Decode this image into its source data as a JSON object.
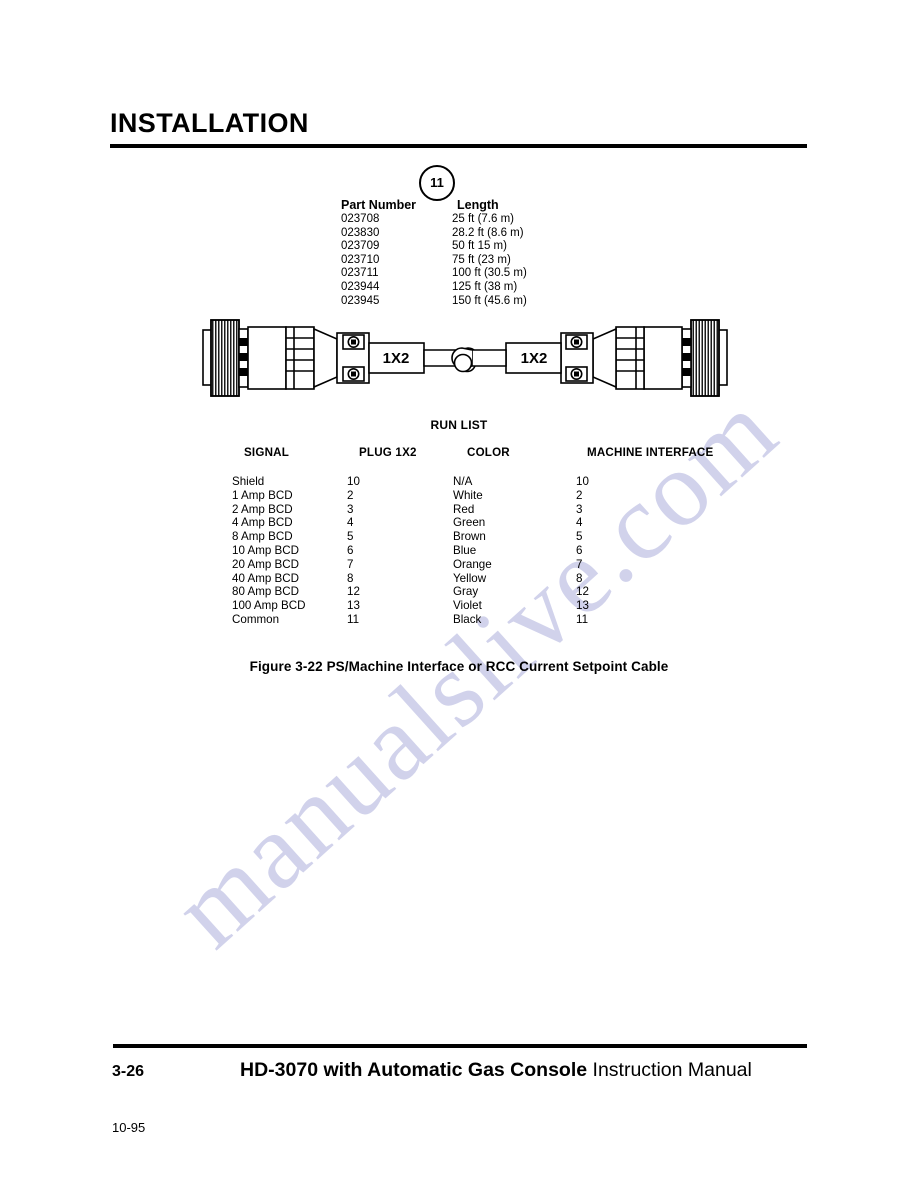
{
  "header": {
    "title": "INSTALLATION"
  },
  "callout": {
    "number": "11"
  },
  "part_table": {
    "headers": [
      "Part Number",
      "Length"
    ],
    "rows": [
      {
        "part_number": "023708",
        "length": "25 ft (7.6 m)"
      },
      {
        "part_number": "023830",
        "length": "28.2 ft (8.6 m)"
      },
      {
        "part_number": "023709",
        "length": "50 ft 15 m)"
      },
      {
        "part_number": "023710",
        "length": "75 ft (23 m)"
      },
      {
        "part_number": "023711",
        "length": "100 ft (30.5 m)"
      },
      {
        "part_number": "023944",
        "length": "125 ft (38 m)"
      },
      {
        "part_number": "023945",
        "length": "150 ft (45.6 m)"
      }
    ]
  },
  "connectors": {
    "left_label": "1X2",
    "right_label": "1X2"
  },
  "run_list": {
    "title": "RUN LIST",
    "headers": [
      "SIGNAL",
      "PLUG 1X2",
      "COLOR",
      "MACHINE INTERFACE"
    ],
    "rows": [
      {
        "signal": "Shield",
        "plug": "10",
        "color": "N/A",
        "machine": "10"
      },
      {
        "signal": "1 Amp BCD",
        "plug": "2",
        "color": "White",
        "machine": "2"
      },
      {
        "signal": "2 Amp BCD",
        "plug": "3",
        "color": "Red",
        "machine": "3"
      },
      {
        "signal": "4 Amp BCD",
        "plug": "4",
        "color": "Green",
        "machine": "4"
      },
      {
        "signal": "8 Amp BCD",
        "plug": "5",
        "color": "Brown",
        "machine": "5"
      },
      {
        "signal": "10 Amp BCD",
        "plug": "6",
        "color": "Blue",
        "machine": "6"
      },
      {
        "signal": "20 Amp BCD",
        "plug": "7",
        "color": "Orange",
        "machine": "7"
      },
      {
        "signal": "40 Amp BCD",
        "plug": "8",
        "color": "Yellow",
        "machine": "8"
      },
      {
        "signal": "80 Amp BCD",
        "plug": "12",
        "color": "Gray",
        "machine": "12"
      },
      {
        "signal": "100 Amp BCD",
        "plug": "13",
        "color": "Violet",
        "machine": "13"
      },
      {
        "signal": "Common",
        "plug": "11",
        "color": "Black",
        "machine": "11"
      }
    ]
  },
  "figure_caption": "Figure 3-22  PS/Machine Interface or RCC Current Setpoint Cable",
  "footer": {
    "page_number": "3-26",
    "manual_title_bold": "HD-3070 with Automatic Gas Console",
    "manual_title_regular": " Instruction Manual",
    "date": "10-95"
  },
  "watermark": {
    "text": "manualslive.com",
    "color": "#c9cbe8"
  }
}
